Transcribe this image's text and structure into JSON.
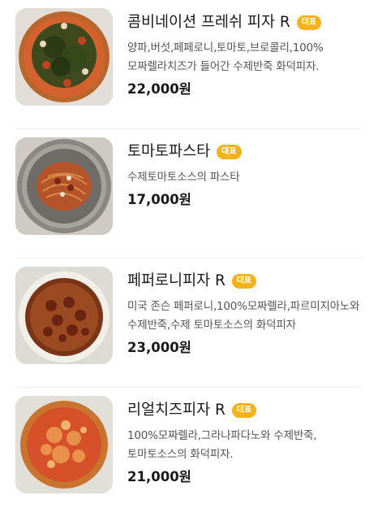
{
  "items": [
    {
      "name": "콤비네이션 프레쉬 피자 R",
      "badge": "대표",
      "description": "양파,버섯,페페로니,토마토,브로콜리,100%모짜렐라치즈가 들어간 수제반죽 화덕피자.",
      "price": "22,000원",
      "image": "pizza-photo"
    },
    {
      "name": "토마토파스타",
      "badge": "대표",
      "description": "수제토마토소스의 파스타",
      "price": "17,000원",
      "image": "pasta-photo"
    },
    {
      "name": "페퍼로니피자 R",
      "badge": "대표",
      "description": "미국 존슨 페퍼로니,100%모짜렐라,파르미지아노와 수제반죽,수제 토마토소스의 화덕피자",
      "price": "23,000원",
      "image": "pizza-photo"
    },
    {
      "name": "리얼치즈피자 R",
      "badge": "대표",
      "description": "100%모짜렐라,그라나파다노와 수제반죽,토마토소스의 화덕피자.",
      "price": "21,000원",
      "image": "pizza-photo"
    }
  ],
  "colors": {
    "badge": "#f7b21a",
    "title": "#1a1a1a",
    "description": "#555555",
    "divider": "#eeeeee"
  }
}
